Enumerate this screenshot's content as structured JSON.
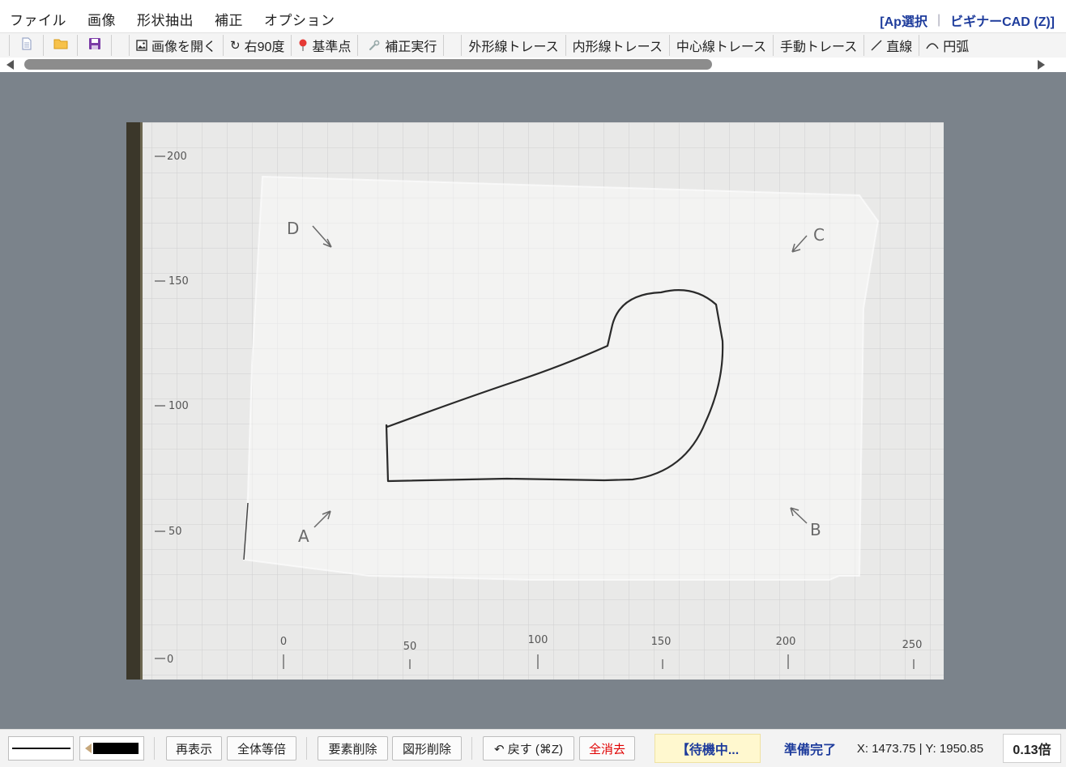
{
  "menubar": {
    "items": [
      "ファイル",
      "画像",
      "形状抽出",
      "補正",
      "オプション"
    ],
    "right": {
      "ap_select": "[Ap選択",
      "sep": "|",
      "beginner": "ビギナーCAD (Z)]"
    }
  },
  "toolbar": {
    "open_image": "画像を開く",
    "rotate_right": "右90度",
    "ref_point": "基準点",
    "apply_correction": "補正実行",
    "outer_trace": "外形線トレース",
    "inner_trace": "内形線トレース",
    "center_trace": "中心線トレース",
    "manual_trace": "手動トレース",
    "line": "直線",
    "arc": "円弧"
  },
  "canvas": {
    "ruler_left": [
      "200",
      "150",
      "100",
      "50",
      "0"
    ],
    "ruler_bottom": [
      "0",
      "50",
      "100",
      "150",
      "200",
      "250"
    ],
    "corner_labels": [
      "D",
      "C",
      "A",
      "B"
    ]
  },
  "statusbar": {
    "redraw": "再表示",
    "fit_all": "全体等倍",
    "delete_element": "要素削除",
    "delete_shape": "図形削除",
    "undo": "↶ 戻す (⌘Z)",
    "clear_all": "全消去",
    "state": "【待機中...",
    "ready": "準備完了",
    "coords": "X: 1473.75 | Y: 1950.85",
    "zoom": "0.13倍"
  },
  "colors": {
    "accent": "#1e3c9c",
    "danger": "#e00000",
    "canvas_bg": "#7b838b",
    "state_bg": "#fff8cf"
  }
}
